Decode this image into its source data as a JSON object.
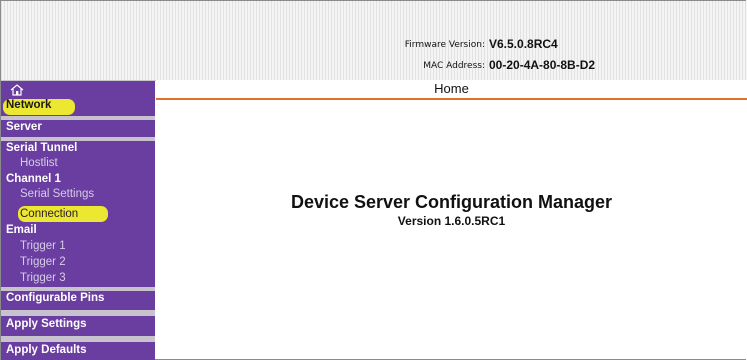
{
  "header": {
    "firmware_label": "Firmware Version:",
    "firmware_value": "V6.5.0.8RC4",
    "mac_label": "MAC Address:",
    "mac_value": "00-20-4A-80-8B-D2"
  },
  "sidebar": {
    "home_icon": "home-icon",
    "items": [
      {
        "label": "Network"
      },
      {
        "label": "Server"
      },
      {
        "label": "Serial Tunnel"
      },
      {
        "label": "Hostlist"
      },
      {
        "label": "Channel 1"
      },
      {
        "label": "Serial Settings"
      },
      {
        "label": "Connection"
      },
      {
        "label": "Email"
      },
      {
        "label": "Trigger 1"
      },
      {
        "label": "Trigger 2"
      },
      {
        "label": "Trigger 3"
      },
      {
        "label": "Configurable Pins"
      },
      {
        "label": "Apply Settings"
      },
      {
        "label": "Apply Defaults"
      }
    ]
  },
  "content": {
    "page_title": "Home",
    "main_title": "Device Server Configuration Manager",
    "version": "Version 1.6.0.5RC1"
  },
  "colors": {
    "sidebar_bg": "#6a3ea0",
    "accent_line": "#e0702a",
    "highlight": "#f3f02a"
  }
}
